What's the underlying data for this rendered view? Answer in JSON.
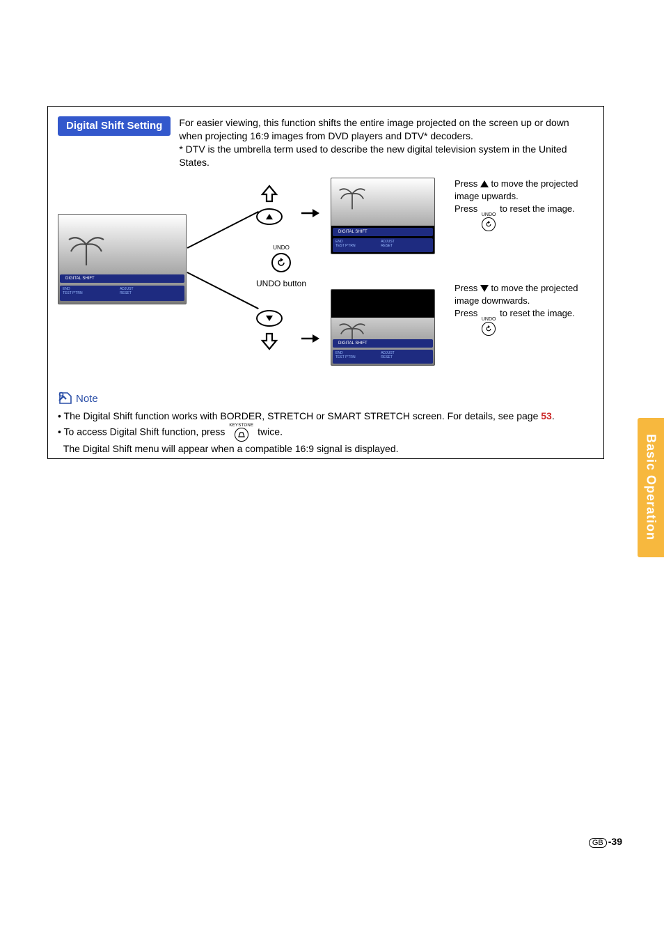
{
  "side_tab": "Basic Operation",
  "pill": "Digital Shift Setting",
  "desc_line1": "For easier viewing, this function shifts the entire image projected on the screen up or down when projecting 16:9 images from DVD players and DTV* decoders.",
  "desc_line2": "* DTV is the umbrella term used to describe the new digital television system in the United States.",
  "diagram": {
    "undo_button_label": "UNDO button",
    "undo_label": "UNDO",
    "osd_title": "DIGITAL SHIFT",
    "osd_sub1_left": "END",
    "osd_sub1_right": "ADJUST",
    "osd_sub2_left": "TEST P'TRN",
    "osd_sub2_right": "RESET"
  },
  "right_up": {
    "l1a": "Press ",
    "l1b": " to move the projected image upwards.",
    "l2a": "Press ",
    "l2b": " to reset the image."
  },
  "right_down": {
    "l1a": "Press ",
    "l1b": " to move the projected image downwards.",
    "l2a": "Press ",
    "l2b": " to reset the image."
  },
  "note_label": "Note",
  "bullets": {
    "b1a": "The Digital Shift function works with BORDER, STRETCH or SMART STRETCH screen. For details, see page ",
    "b1_link": "53",
    "b1b": ".",
    "b2a": "To access Digital Shift function, press ",
    "b2b": " twice.",
    "b3": "The Digital Shift menu will appear when a compatible 16:9 signal is displayed.",
    "keystone_label": "KEYSTONE"
  },
  "page_number": "-39",
  "gb": "GB"
}
